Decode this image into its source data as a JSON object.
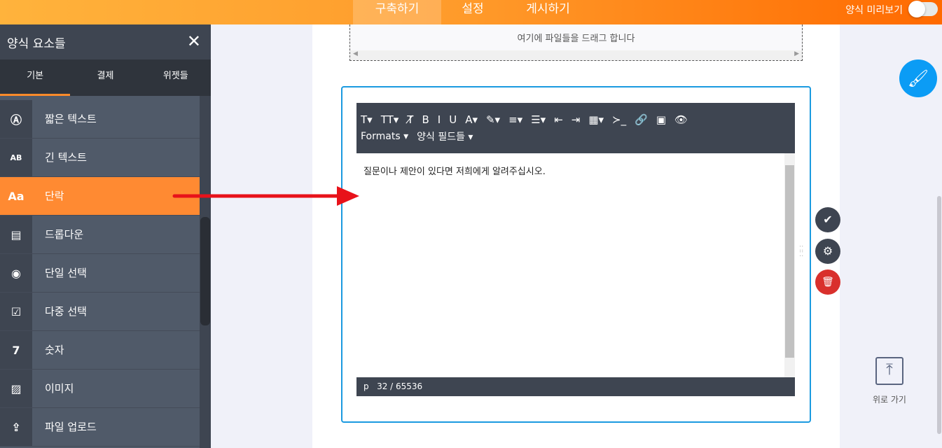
{
  "header": {
    "tabs": [
      {
        "label": "구축하기",
        "active": true
      },
      {
        "label": "설정"
      },
      {
        "label": "게시하기"
      }
    ],
    "preview_label": "양식 미리보기",
    "preview_on": false
  },
  "sidebar": {
    "title": "양식 요소들",
    "tabs": [
      "기본",
      "결제",
      "위젯들"
    ],
    "items": [
      {
        "icon": "Ⓐ",
        "label": "짧은 텍스트"
      },
      {
        "icon": "AB",
        "label": "긴 텍스트"
      },
      {
        "icon": "Aa",
        "label": "단락"
      },
      {
        "icon": "▤",
        "label": "드롭다운"
      },
      {
        "icon": "◉",
        "label": "단일 선택"
      },
      {
        "icon": "☑",
        "label": "다중 선택"
      },
      {
        "icon": "7",
        "label": "숫자"
      },
      {
        "icon": "▨",
        "label": "이미지"
      },
      {
        "icon": "⇪",
        "label": "파일 업로드"
      }
    ]
  },
  "dropzone": {
    "text": "여기에 파일들을 드래그 합니다"
  },
  "editor": {
    "toolbar": [
      "T▾",
      "TT▾",
      "T̸",
      "B",
      "I",
      "U",
      "A▾",
      "✎▾",
      "≡▾",
      "☰▾",
      "⇤",
      "⇥",
      "▦▾",
      "≻_",
      "🔗",
      "▣",
      "👁"
    ],
    "formats_label": "Formats ▾",
    "fields_label": "양식 필드들 ▾",
    "content": "질문이나 제안이 있다면 저희에게 알려주십시오.",
    "status_tag": "p",
    "status_count": "32 / 65536"
  },
  "controls": {
    "check": "✔",
    "settings": "⚙",
    "delete": "🗑"
  },
  "back_to_top": "위로 가기"
}
